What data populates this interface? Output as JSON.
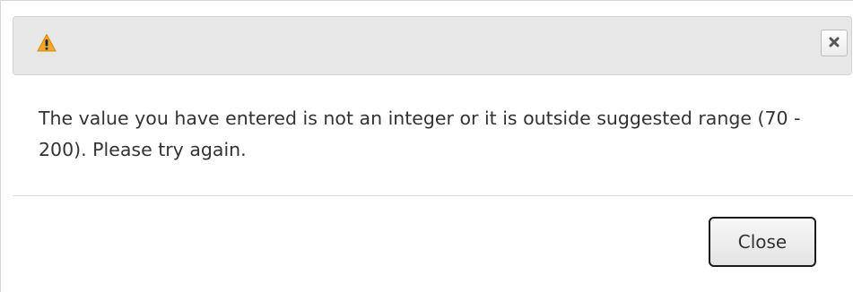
{
  "dialog": {
    "title_icon": "warning-icon",
    "close_icon": "close-icon",
    "message": "The value you have entered is not an integer or it is outside suggested range (70 - 200). Please try again.",
    "close_button_label": "Close",
    "colors": {
      "warning": "#f5a623",
      "titlebar_bg": "#e7e7e7",
      "text": "#333333"
    }
  }
}
